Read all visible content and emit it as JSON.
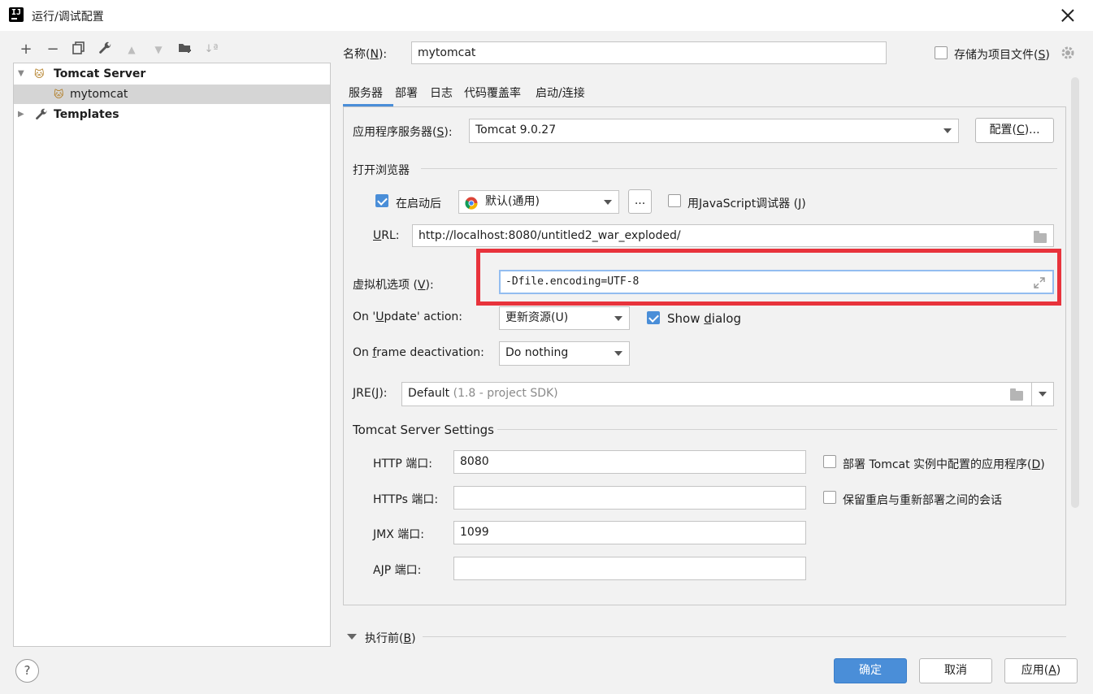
{
  "window": {
    "title": "运行/调试配置"
  },
  "toolbar": {
    "add": "+",
    "remove": "−",
    "copy": "⧉",
    "edit": "🔧",
    "up": "▲",
    "down": "▼",
    "folder": "📁",
    "sort": "↓ª"
  },
  "tree": {
    "group_label": "Tomcat Server",
    "child_label": "mytomcat",
    "templates_label": "Templates"
  },
  "name": {
    "label": "名称(N):",
    "label_main": "名称(",
    "label_key": "N",
    "label_end": "):",
    "value": "mytomcat"
  },
  "store_project_file": {
    "label_main": "存储为项目文件(",
    "label_key": "S",
    "label_end": ")",
    "checked": false
  },
  "tabs": [
    "服务器",
    "部署",
    "日志",
    "代码覆盖率",
    "启动/连接"
  ],
  "server": {
    "app_server_label_main": "应用程序服务器(",
    "app_server_key": "S",
    "app_server_end": "):",
    "app_server_value": "Tomcat 9.0.27",
    "configure_main": "配置(",
    "configure_key": "C",
    "configure_end": ")..."
  },
  "browser": {
    "section_label": "打开浏览器",
    "after_launch_label": "在启动后",
    "after_launch_checked": true,
    "browser_value": "默认(通用)",
    "more_label": "...",
    "js_debugger_label_main": "用JavaScript调试器 (",
    "js_debugger_key": "J",
    "js_debugger_end": ")",
    "js_debugger_checked": false,
    "url_label_key": "U",
    "url_label_end": "RL:",
    "url_value": "http://localhost:8080/untitled2_war_exploded/"
  },
  "vm": {
    "label_main": "虚拟机选项 (",
    "label_key": "V",
    "label_end": "):",
    "value": "-Dfile.encoding=UTF-8"
  },
  "update": {
    "label_pre": "On '",
    "label_key": "U",
    "label_end": "pdate' action:",
    "value": "更新资源(U)",
    "show_dialog_main": "Show ",
    "show_dialog_key": "d",
    "show_dialog_end": "ialog",
    "show_dialog_checked": true
  },
  "frame": {
    "label_pre": "On ",
    "label_key": "f",
    "label_end": "rame deactivation:",
    "value": "Do nothing"
  },
  "jre": {
    "label_main": "JRE(",
    "label_key": "J",
    "label_end": "):",
    "value": "Default",
    "value_hint": "(1.8 - project SDK)"
  },
  "tomcat_settings": {
    "section_label": "Tomcat Server Settings",
    "http_label": "HTTP 端口:",
    "http_value": "8080",
    "https_label": "HTTPs 端口:",
    "https_value": "",
    "jmx_label": "JMX 端口:",
    "jmx_value": "1099",
    "ajp_label": "AJP 端口:",
    "ajp_value": "",
    "deploy_apps_main": "部署 Tomcat 实例中配置的应用程序(",
    "deploy_apps_key": "D",
    "deploy_apps_end": ")",
    "deploy_apps_checked": false,
    "preserve_sessions_label": "保留重启与重新部署之间的会话",
    "preserve_sessions_checked": false
  },
  "before_launch": {
    "label_main": "执行前(",
    "label_key": "B",
    "label_end": ")"
  },
  "footer": {
    "help_label": "?",
    "ok_label": "确定",
    "cancel_label": "取消",
    "apply_main": "应用(",
    "apply_key": "A",
    "apply_end": ")"
  },
  "colors": {
    "accent": "#4a8ed8",
    "highlight_box": "#e8333c",
    "selection": "#d5d5d5"
  }
}
